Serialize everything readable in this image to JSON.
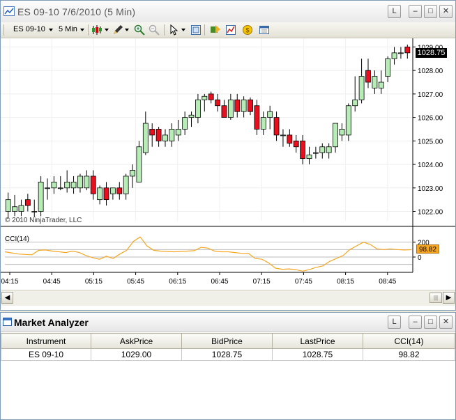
{
  "chart_window": {
    "title": "ES 09-10  7/6/2010 (5 Min)",
    "buttons": {
      "link": "L"
    },
    "toolbar": {
      "instrument": "ES 09-10",
      "interval": "5 Min"
    }
  },
  "chart_data": {
    "type": "candlestick",
    "watermark": "© 2010 NinjaTrader, LLC",
    "price_axis": {
      "ticks": [
        "1022.00",
        "1023.00",
        "1024.00",
        "1025.00",
        "1026.00",
        "1027.00",
        "1028.00",
        "1029.00"
      ],
      "range": [
        1021.6,
        1029.25
      ],
      "last_price_label": "1028.75"
    },
    "time_axis": {
      "labels": [
        "04:15",
        "04:45",
        "05:15",
        "05:45",
        "06:15",
        "06:45",
        "07:15",
        "07:45",
        "08:15",
        "08:45"
      ]
    },
    "candles": [
      {
        "o": 1022.0,
        "h": 1022.8,
        "l": 1021.7,
        "c": 1022.5
      },
      {
        "o": 1022.0,
        "h": 1022.7,
        "l": 1021.8,
        "c": 1022.2
      },
      {
        "o": 1022.0,
        "h": 1022.5,
        "l": 1021.8,
        "c": 1022.25
      },
      {
        "o": 1022.5,
        "h": 1022.75,
        "l": 1022.0,
        "c": 1022.25
      },
      {
        "o": 1022.0,
        "h": 1022.5,
        "l": 1021.75,
        "c": 1022.0
      },
      {
        "o": 1022.0,
        "h": 1023.5,
        "l": 1021.8,
        "c": 1023.25
      },
      {
        "o": 1023.0,
        "h": 1023.4,
        "l": 1022.5,
        "c": 1023.0
      },
      {
        "o": 1023.0,
        "h": 1023.5,
        "l": 1022.75,
        "c": 1023.25
      },
      {
        "o": 1023.0,
        "h": 1023.5,
        "l": 1022.9,
        "c": 1023.0
      },
      {
        "o": 1023.0,
        "h": 1023.75,
        "l": 1022.8,
        "c": 1023.25
      },
      {
        "o": 1023.0,
        "h": 1023.5,
        "l": 1022.75,
        "c": 1023.25
      },
      {
        "o": 1023.0,
        "h": 1023.6,
        "l": 1022.8,
        "c": 1023.5
      },
      {
        "o": 1023.0,
        "h": 1023.75,
        "l": 1022.9,
        "c": 1023.5
      },
      {
        "o": 1023.5,
        "h": 1023.75,
        "l": 1022.5,
        "c": 1022.75
      },
      {
        "o": 1022.5,
        "h": 1023.1,
        "l": 1022.3,
        "c": 1023.0
      },
      {
        "o": 1023.0,
        "h": 1023.25,
        "l": 1022.25,
        "c": 1022.5
      },
      {
        "o": 1022.75,
        "h": 1023.0,
        "l": 1022.5,
        "c": 1023.0
      },
      {
        "o": 1023.0,
        "h": 1023.25,
        "l": 1022.5,
        "c": 1022.75
      },
      {
        "o": 1022.75,
        "h": 1023.6,
        "l": 1022.5,
        "c": 1023.5
      },
      {
        "o": 1023.5,
        "h": 1024.0,
        "l": 1023.0,
        "c": 1023.75
      },
      {
        "o": 1023.25,
        "h": 1025.0,
        "l": 1023.25,
        "c": 1024.75
      },
      {
        "o": 1024.5,
        "h": 1026.25,
        "l": 1024.4,
        "c": 1025.75
      },
      {
        "o": 1025.5,
        "h": 1025.75,
        "l": 1024.75,
        "c": 1025.25
      },
      {
        "o": 1025.5,
        "h": 1025.6,
        "l": 1024.75,
        "c": 1025.0
      },
      {
        "o": 1025.0,
        "h": 1025.5,
        "l": 1024.75,
        "c": 1025.25
      },
      {
        "o": 1025.0,
        "h": 1025.75,
        "l": 1024.75,
        "c": 1025.5
      },
      {
        "o": 1025.25,
        "h": 1025.9,
        "l": 1025.0,
        "c": 1025.5
      },
      {
        "o": 1025.5,
        "h": 1026.25,
        "l": 1025.25,
        "c": 1026.0
      },
      {
        "o": 1026.0,
        "h": 1026.25,
        "l": 1025.6,
        "c": 1026.1
      },
      {
        "o": 1026.0,
        "h": 1027.0,
        "l": 1025.75,
        "c": 1026.75
      },
      {
        "o": 1026.75,
        "h": 1027.0,
        "l": 1026.25,
        "c": 1026.9
      },
      {
        "o": 1027.0,
        "h": 1027.1,
        "l": 1026.6,
        "c": 1026.75
      },
      {
        "o": 1026.75,
        "h": 1027.0,
        "l": 1026.25,
        "c": 1026.5
      },
      {
        "o": 1026.5,
        "h": 1026.75,
        "l": 1026.0,
        "c": 1026.0
      },
      {
        "o": 1026.0,
        "h": 1027.0,
        "l": 1025.9,
        "c": 1026.75
      },
      {
        "o": 1026.75,
        "h": 1027.0,
        "l": 1026.0,
        "c": 1026.25
      },
      {
        "o": 1026.25,
        "h": 1026.9,
        "l": 1026.0,
        "c": 1026.75
      },
      {
        "o": 1026.75,
        "h": 1026.85,
        "l": 1026.1,
        "c": 1026.25
      },
      {
        "o": 1026.5,
        "h": 1026.75,
        "l": 1025.25,
        "c": 1025.5
      },
      {
        "o": 1025.5,
        "h": 1026.25,
        "l": 1025.25,
        "c": 1026.0
      },
      {
        "o": 1026.0,
        "h": 1026.5,
        "l": 1025.5,
        "c": 1026.25
      },
      {
        "o": 1026.0,
        "h": 1026.25,
        "l": 1025.0,
        "c": 1025.25
      },
      {
        "o": 1025.25,
        "h": 1025.5,
        "l": 1024.75,
        "c": 1025.25
      },
      {
        "o": 1025.25,
        "h": 1025.5,
        "l": 1024.75,
        "c": 1024.9
      },
      {
        "o": 1025.0,
        "h": 1025.25,
        "l": 1024.5,
        "c": 1024.75
      },
      {
        "o": 1025.0,
        "h": 1025.25,
        "l": 1024.0,
        "c": 1024.25
      },
      {
        "o": 1024.25,
        "h": 1024.75,
        "l": 1024.0,
        "c": 1024.4
      },
      {
        "o": 1024.5,
        "h": 1024.75,
        "l": 1024.25,
        "c": 1024.5
      },
      {
        "o": 1024.5,
        "h": 1024.9,
        "l": 1024.25,
        "c": 1024.75
      },
      {
        "o": 1024.5,
        "h": 1024.9,
        "l": 1024.25,
        "c": 1024.75
      },
      {
        "o": 1024.75,
        "h": 1025.75,
        "l": 1024.5,
        "c": 1025.75
      },
      {
        "o": 1025.25,
        "h": 1025.75,
        "l": 1025.0,
        "c": 1025.5
      },
      {
        "o": 1025.25,
        "h": 1026.6,
        "l": 1025.0,
        "c": 1026.5
      },
      {
        "o": 1026.5,
        "h": 1027.75,
        "l": 1026.25,
        "c": 1026.75
      },
      {
        "o": 1026.75,
        "h": 1028.5,
        "l": 1026.6,
        "c": 1027.75
      },
      {
        "o": 1028.0,
        "h": 1028.5,
        "l": 1027.25,
        "c": 1027.5
      },
      {
        "o": 1027.25,
        "h": 1028.0,
        "l": 1027.0,
        "c": 1027.75
      },
      {
        "o": 1027.25,
        "h": 1028.0,
        "l": 1027.0,
        "c": 1027.5
      },
      {
        "o": 1027.75,
        "h": 1028.6,
        "l": 1027.5,
        "c": 1028.5
      },
      {
        "o": 1028.5,
        "h": 1029.0,
        "l": 1028.25,
        "c": 1028.75
      },
      {
        "o": 1028.75,
        "h": 1029.0,
        "l": 1028.5,
        "c": 1028.75
      },
      {
        "o": 1029.0,
        "h": 1029.1,
        "l": 1028.5,
        "c": 1028.75
      }
    ],
    "cci": {
      "label": "CCI(14)",
      "ticks": [
        "200",
        "0"
      ],
      "range": [
        -150,
        300
      ],
      "last_value": "98.82",
      "values": [
        70,
        55,
        40,
        35,
        30,
        90,
        95,
        80,
        70,
        60,
        80,
        60,
        20,
        -10,
        -30,
        10,
        -20,
        40,
        90,
        210,
        270,
        150,
        90,
        80,
        75,
        70,
        75,
        80,
        85,
        130,
        120,
        80,
        70,
        70,
        60,
        50,
        50,
        -20,
        -30,
        -80,
        -150,
        -165,
        -160,
        -170,
        -190,
        -170,
        -140,
        -120,
        -60,
        -20,
        20,
        100,
        150,
        200,
        170,
        110,
        100,
        110,
        100,
        95,
        98.82
      ]
    }
  },
  "market_analyzer": {
    "title": "Market Analyzer",
    "columns": [
      "Instrument",
      "AskPrice",
      "BidPrice",
      "LastPrice",
      "CCI(14)"
    ],
    "rows": [
      [
        "ES 09-10",
        "1029.00",
        "1028.75",
        "1028.75",
        "98.82"
      ]
    ]
  },
  "colors": {
    "up": "#b7ecb7",
    "down": "#e8101e",
    "cci_line": "#f5a623"
  }
}
